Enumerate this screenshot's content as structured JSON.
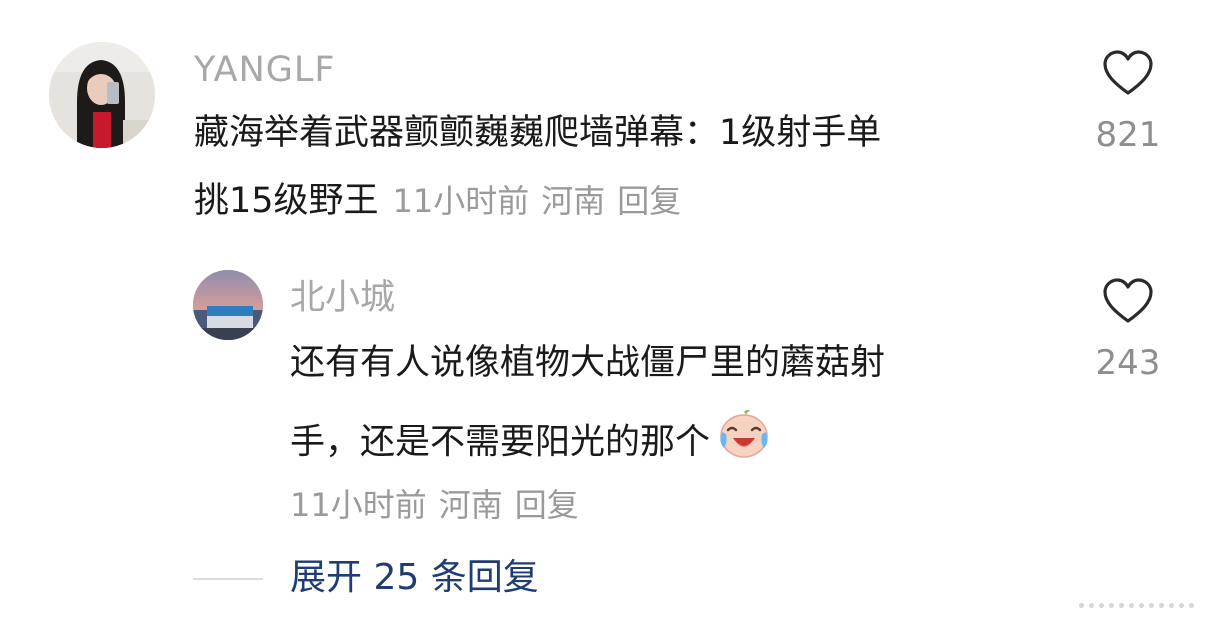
{
  "comments": [
    {
      "username": "YANGLF",
      "text_line1": "藏海举着武器颤颤巍巍爬墙弹幕：1级射手单",
      "text_line2": "挑15级野王",
      "time": "11小时前",
      "location": "河南",
      "reply_label": "回复",
      "like_count": "821",
      "icon": "heart-outline-icon"
    },
    {
      "username": "北小城",
      "text_line1": "还有有人说像植物大战僵尸里的蘑菇射",
      "text_line2": "手，还是不需要阳光的那个",
      "time": "11小时前",
      "location": "河南",
      "reply_label": "回复",
      "like_count": "243",
      "icon": "heart-outline-icon",
      "emoji": "laughing-tears-emoji"
    }
  ],
  "expand": {
    "label": "展开 25 条回复",
    "color": "#1f3c73"
  },
  "colors": {
    "username": "#a8a8a8",
    "meta": "#9a9a9a",
    "text": "#1a1a1a",
    "like_count": "#8e8e8e"
  }
}
